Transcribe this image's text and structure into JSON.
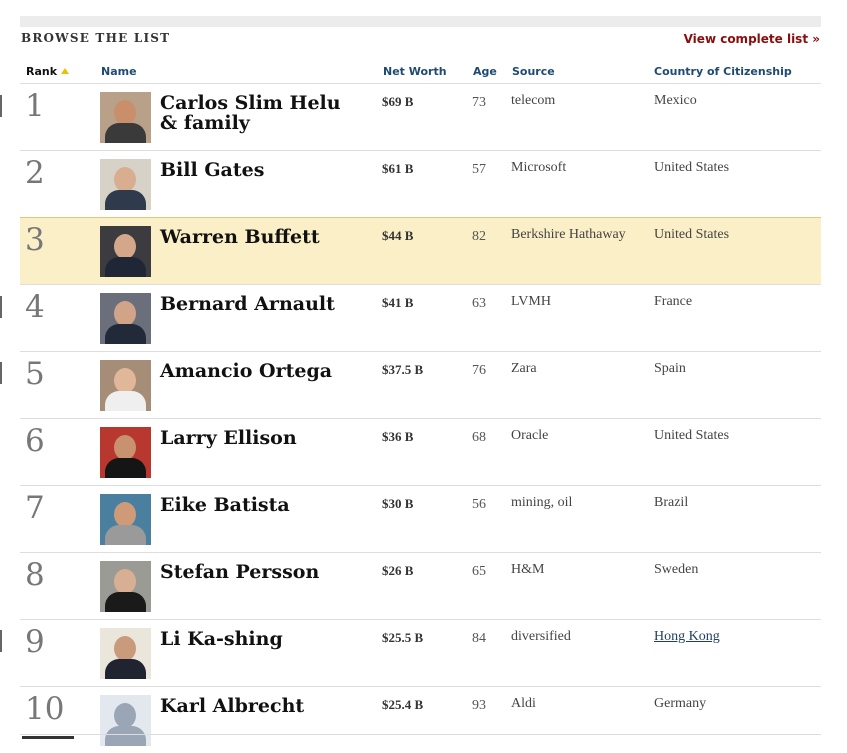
{
  "header": {
    "section_title": "BROWSE THE LIST",
    "view_all_label": "View complete list »"
  },
  "columns": {
    "rank": "Rank",
    "name": "Name",
    "net_worth": "Net Worth",
    "age": "Age",
    "source": "Source",
    "country": "Country of Citizenship"
  },
  "rows": [
    {
      "rank": "1",
      "name": "Carlos Slim Helu & family",
      "net_worth": "$69 B",
      "age": "73",
      "source": "telecom",
      "country": "Mexico"
    },
    {
      "rank": "2",
      "name": "Bill Gates",
      "net_worth": "$61 B",
      "age": "57",
      "source": "Microsoft",
      "country": "United States"
    },
    {
      "rank": "3",
      "name": "Warren Buffett",
      "net_worth": "$44 B",
      "age": "82",
      "source": "Berkshire Hathaway",
      "country": "United States"
    },
    {
      "rank": "4",
      "name": "Bernard Arnault",
      "net_worth": "$41 B",
      "age": "63",
      "source": "LVMH",
      "country": "France"
    },
    {
      "rank": "5",
      "name": "Amancio Ortega",
      "net_worth": "$37.5 B",
      "age": "76",
      "source": "Zara",
      "country": "Spain"
    },
    {
      "rank": "6",
      "name": "Larry Ellison",
      "net_worth": "$36 B",
      "age": "68",
      "source": "Oracle",
      "country": "United States"
    },
    {
      "rank": "7",
      "name": "Eike Batista",
      "net_worth": "$30 B",
      "age": "56",
      "source": "mining, oil",
      "country": "Brazil"
    },
    {
      "rank": "8",
      "name": "Stefan Persson",
      "net_worth": "$26 B",
      "age": "65",
      "source": "H&M",
      "country": "Sweden"
    },
    {
      "rank": "9",
      "name": "Li Ka-shing",
      "net_worth": "$25.5 B",
      "age": "84",
      "source": "diversified",
      "country": "Hong Kong"
    },
    {
      "rank": "10",
      "name": "Karl Albrecht",
      "net_worth": "$25.4 B",
      "age": "93",
      "source": "Aldi",
      "country": "Germany"
    }
  ],
  "colors": {
    "highlight_row": "#fbefc7",
    "link_red": "#8b0d0d",
    "header_blue": "#1f4a74"
  }
}
